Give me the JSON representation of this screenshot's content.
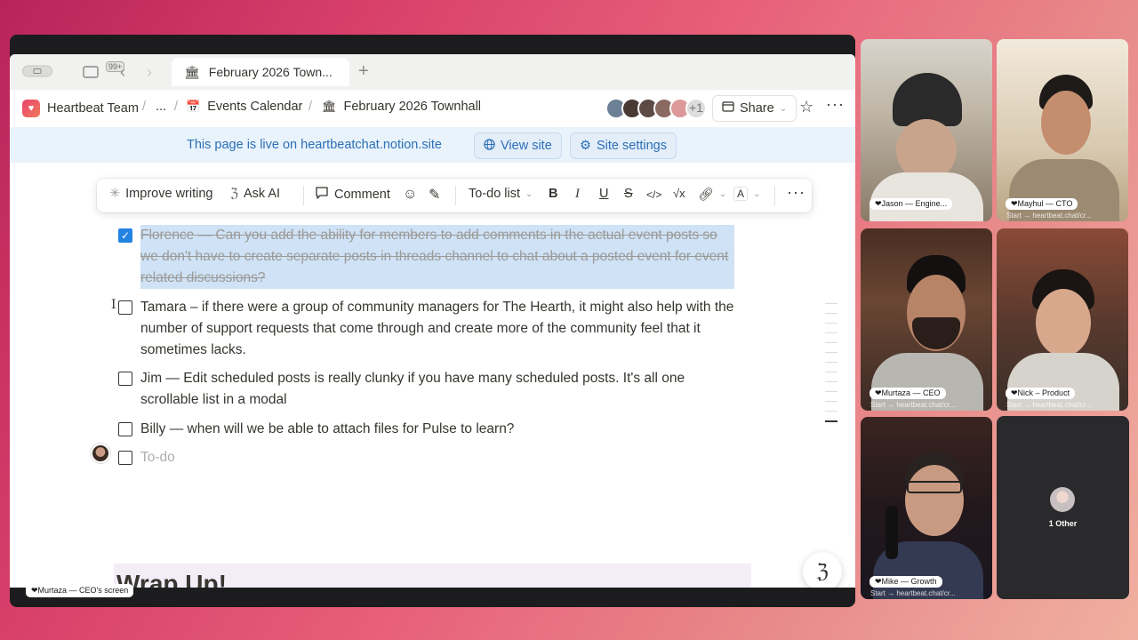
{
  "browser": {
    "tab_badge": "99+",
    "tab_title": "February 2026 Town...",
    "new_tab_glyph": "+"
  },
  "breadcrumb": {
    "workspace": "Heartbeat Team",
    "ellipsis": "...",
    "parent": "Events Calendar",
    "current": "February 2026 Townhall"
  },
  "topbar": {
    "extra_viewers": "+1",
    "share_label": "Share"
  },
  "live_banner": {
    "text": "This page is live on heartbeatchat.notion.site",
    "view_site": "View site",
    "site_settings": "Site settings"
  },
  "toolbar": {
    "improve": "Improve writing",
    "ask_ai": "Ask AI",
    "comment": "Comment",
    "block_type": "To-do list",
    "bold": "B",
    "italic": "I",
    "underline": "U",
    "strike": "S",
    "code": "</>",
    "math": "√x",
    "color": "A",
    "more": "···"
  },
  "todos": [
    {
      "text": "Florence — Can you add the ability for members to add comments in the actual event posts so we don't have to create separate posts in threads channel to chat about a posted event for event related discussions?",
      "checked": true
    },
    {
      "text": "Tamara – if there were a group of community managers for The Hearth, it might also help with the number of support requests that come through and create more of the community feel that it sometimes lacks.",
      "checked": false
    },
    {
      "text": "Jim — Edit scheduled posts is really clunky if you have many scheduled posts. It's all one scrollable list in a modal",
      "checked": false
    },
    {
      "text": "Billy — when will we be able to attach files for Pulse to learn?",
      "checked": false
    },
    {
      "text": "To-do",
      "checked": false,
      "placeholder": true
    }
  ],
  "next_heading": "Wrap Up!",
  "screen_share_label": "❤Murtaza — CEO's screen",
  "participants": [
    {
      "name": "❤Jason — Engine...",
      "sub": ""
    },
    {
      "name": "❤Mayhul — CTO",
      "sub": "Start → heartbeat.chat/cr..."
    },
    {
      "name": "❤Murtaza — CEO",
      "sub": "Start → heartbeat.chat/cr..."
    },
    {
      "name": "❤Nick – Product",
      "sub": "Start → heartbeat.chat/cr..."
    },
    {
      "name": "❤Mike — Growth",
      "sub": "Start → heartbeat.chat/cr..."
    }
  ],
  "others_label": "1 Other",
  "colors": {
    "notion_blue": "#2383e2",
    "banner_blue": "#2b6fb7",
    "text": "#37352f"
  }
}
